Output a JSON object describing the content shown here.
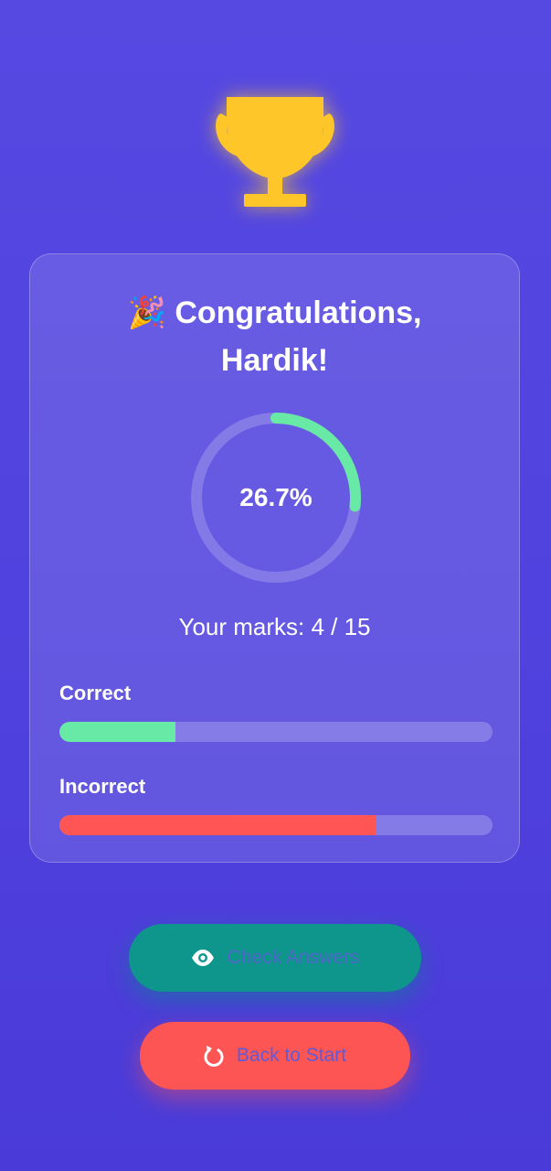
{
  "result": {
    "greeting_line1": "🎉 Congratulations,",
    "greeting_line2": "Hardik!",
    "percentage_text": "26.7%",
    "percentage_value": 26.7,
    "marks_text": "Your marks: 4 / 15",
    "marks_obtained": 4,
    "marks_total": 15
  },
  "stats": {
    "correct_label": "Correct",
    "correct_fraction": 0.267,
    "incorrect_label": "Incorrect",
    "incorrect_fraction": 0.733
  },
  "actions": {
    "check_answers_label": "Check Answers",
    "back_to_start_label": "Back to Start"
  },
  "icons": {
    "trophy": "trophy-icon",
    "check_answers": "eye-icon",
    "back_to_start": "restart-icon"
  },
  "colors": {
    "background": "#5246e0",
    "trophy": "#ffc62a",
    "correct": "#69e9a6",
    "incorrect": "#ff5555",
    "check_button": "#0e968c",
    "start_button": "#fd5553"
  }
}
